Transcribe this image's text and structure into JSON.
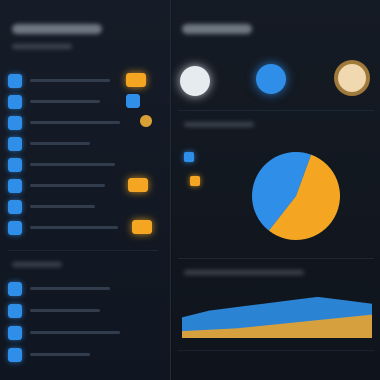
{
  "colors": {
    "accent_blue": "#2f8fe8",
    "accent_orange": "#f4a623",
    "panel_dark": "#121821"
  },
  "left_panel": {
    "icons": [
      "square-icon",
      "square-icon",
      "square-icon",
      "square-icon",
      "square-icon",
      "square-icon",
      "square-icon",
      "square-icon",
      "square-icon",
      "square-icon",
      "square-icon"
    ]
  },
  "right_panel": {
    "top_indicators": [
      "circle-indicator",
      "circle-indicator",
      "circle-indicator"
    ],
    "legend": [
      "blue",
      "orange"
    ]
  },
  "chart_data": [
    {
      "type": "pie",
      "values": [
        55,
        45
      ]
    },
    {
      "type": "area",
      "series": [
        {
          "values": [
            30,
            40,
            45,
            50,
            55,
            60,
            55,
            50
          ]
        },
        {
          "values": [
            10,
            12,
            14,
            18,
            22,
            26,
            30,
            34
          ]
        }
      ]
    }
  ]
}
